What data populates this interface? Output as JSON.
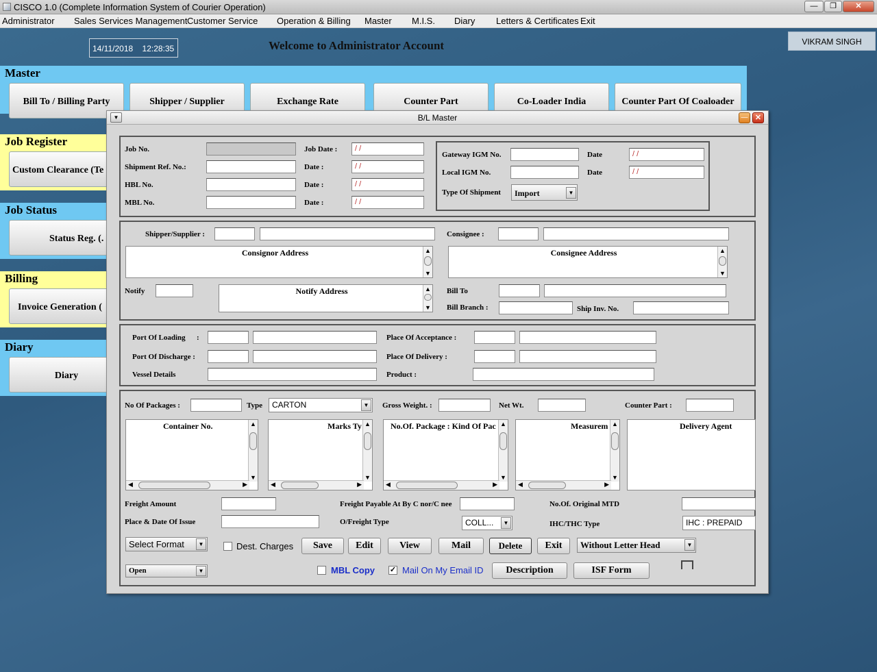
{
  "window": {
    "title": "CISCO 1.0 (Complete Information System of Courier Operation)",
    "minimize": "—",
    "maximize": "❐",
    "close": "✕"
  },
  "menu": [
    "Administrator",
    "Sales Services Management",
    "Customer Service",
    "Operation & Billing",
    "Master",
    "M.I.S.",
    "Diary",
    "Letters & Certificates",
    "Exit"
  ],
  "header": {
    "date": "14/11/2018",
    "time": "12:28:35",
    "welcome": "Welcome to Administrator Account",
    "user": "VIKRAM SINGH"
  },
  "sections": {
    "master": {
      "title": "Master",
      "buttons": [
        "Bill To / Billing Party",
        "Shipper / Supplier",
        "Exchange Rate",
        "Counter Part",
        "Co-Loader India",
        "Counter Part Of Coaloader"
      ]
    },
    "job_register": {
      "title": "Job Register",
      "button": "Custom Clearance (Te"
    },
    "job_status": {
      "title": "Job Status",
      "button": "Status Reg. (."
    },
    "billing": {
      "title": "Billing",
      "button": "Invoice Generation ("
    },
    "diary": {
      "title": "Diary",
      "button": "Diary"
    }
  },
  "dialog": {
    "title": "B/L Master",
    "panel1": {
      "job_no": "Job No.",
      "job_date": "Job Date :",
      "shipment_ref": "Shipment Ref. No.:",
      "date_lbl": "Date    :",
      "hbl_no": "HBL No.",
      "mbl_no": "MBL No.",
      "date_value": "/ /",
      "gateway_igm": "Gateway IGM No.",
      "local_igm": "Local IGM No.",
      "date": "Date",
      "type_of_shipment": "Type Of Shipment",
      "shipment_type_value": "Import"
    },
    "panel2": {
      "shipper": "Shipper/Supplier :",
      "consignee": "Consignee :",
      "consignor_address": "Consignor Address",
      "consignee_address": "Consignee Address",
      "notify": "Notify",
      "notify_address": "Notify Address",
      "bill_to": "Bill To",
      "bill_branch": "Bill Branch :",
      "ship_inv_no": "Ship Inv. No."
    },
    "panel3": {
      "port_loading": "Port Of Loading",
      "colon": ":",
      "port_discharge": "Port Of Discharge :",
      "vessel_details": "Vessel Details",
      "place_acceptance": "Place Of Acceptance :",
      "place_delivery": "Place Of Delivery :",
      "product": "Product :"
    },
    "panel4": {
      "no_packages": "No Of Packages :",
      "type": "Type",
      "type_value": "CARTON",
      "gross_weight": "Gross Weight. :",
      "net_wt": "Net Wt.",
      "counter_part": "Counter Part :",
      "container_no": "Container No.",
      "marks": "Marks Ty",
      "no_of_package": "No.Of. Package : Kind Of Pac",
      "measurement": "Measurem",
      "delivery_agent": "Delivery Agent",
      "freight_amount": "Freight Amount",
      "freight_payable": "Freight Payable At By C nor/C nee",
      "no_original_mtd": "No.Of. Original MTD",
      "place_date_issue": "Place & Date Of Issue",
      "o_freight_type": "O/Freight Type",
      "freight_type_value": "COLL...",
      "ihc_thc_type": "IHC/THC Type",
      "ihc_value": "IHC : PREPAID",
      "select_format": "Select Format",
      "dest_charges": "Dest. Charges",
      "save": "Save",
      "edit": "Edit",
      "view": "View",
      "mail": "Mail",
      "delete": "Delete",
      "exit": "Exit",
      "letter_head": "Without Letter Head",
      "open": "Open",
      "mbl_copy": "MBL Copy",
      "mail_on_email": "Mail On My Email ID",
      "description": "Description",
      "isf_form": "ISF Form"
    }
  }
}
